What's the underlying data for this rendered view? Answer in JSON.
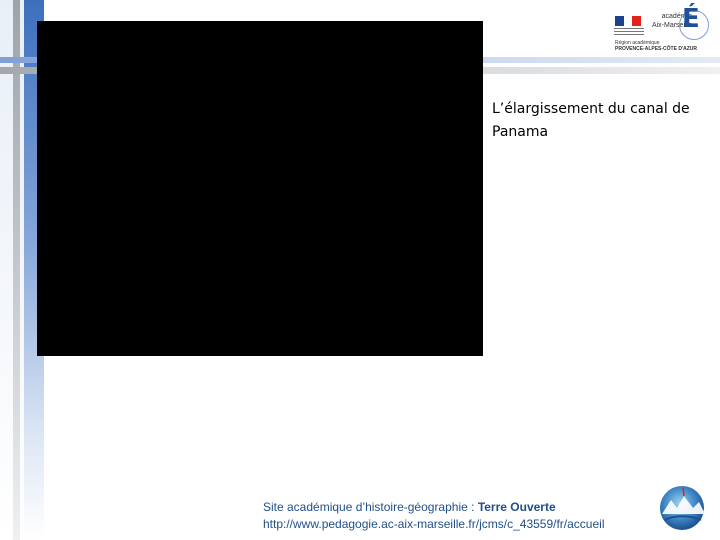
{
  "logo": {
    "flag_colors": [
      "#1f3f8f",
      "#ffffff",
      "#e2231a"
    ],
    "academy_name_line1": "académie",
    "academy_name_line2": "Aix-Marseille",
    "academy_letter": "É",
    "region_line1": "Région académique",
    "region_line2": "PROVENCE-ALPES-CÔTE D'AZUR"
  },
  "video": {
    "background": "#000000"
  },
  "slide": {
    "title": "L’élargissement du canal de Panama"
  },
  "footer": {
    "site_label": "Site académique d’histoire-géographie : ",
    "site_brand": "Terre Ouverte",
    "url": "http://www.pedagogie.ac-aix-marseille.fr/jcms/c_43559/fr/accueil",
    "logo_icon": "terre-ouverte-globe-icon"
  }
}
